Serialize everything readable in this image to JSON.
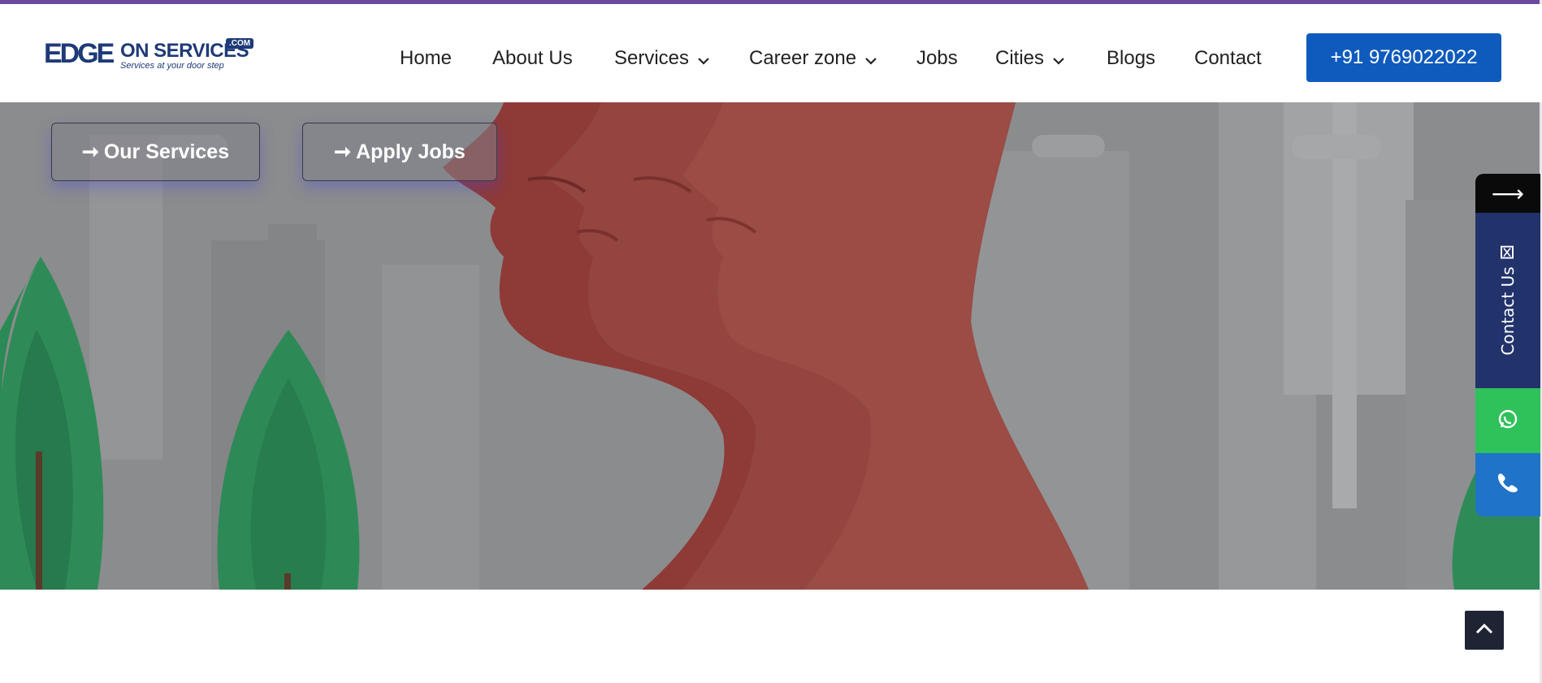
{
  "brand": {
    "logo_edge": "EDGE",
    "logo_main": "ON SERVICES",
    "logo_com": ".COM",
    "tagline": "Services at your door step"
  },
  "nav": {
    "items": [
      {
        "label": "Home",
        "icon": ""
      },
      {
        "label": "About Us",
        "icon": ""
      },
      {
        "label": "Services",
        "icon": "chevron-down-icon"
      },
      {
        "label": "Career zone",
        "icon": "chevron-down-icon"
      },
      {
        "label": "Jobs",
        "icon": ""
      },
      {
        "label": "Cities",
        "icon": "chevron-down-icon"
      },
      {
        "label": "Blogs",
        "icon": ""
      },
      {
        "label": "Contact",
        "icon": ""
      }
    ],
    "phone_button": "+91 9769022022"
  },
  "hero": {
    "buttons": [
      {
        "label": "Our Services",
        "icon": "arrow-right-icon"
      },
      {
        "label": "Apply Jobs",
        "icon": "arrow-right-icon"
      }
    ]
  },
  "side_widget": {
    "toggle_icon": "arrow-right-icon",
    "contact_label": "Contact Us",
    "whatsapp_icon": "whatsapp-icon",
    "phone_icon": "phone-icon"
  },
  "colors": {
    "accent_stripe": "#6b4ba0",
    "phone_button": "#0f5bbd",
    "contact_panel": "#22336b",
    "whatsapp": "#2fc15a",
    "phone": "#1f74c9"
  }
}
